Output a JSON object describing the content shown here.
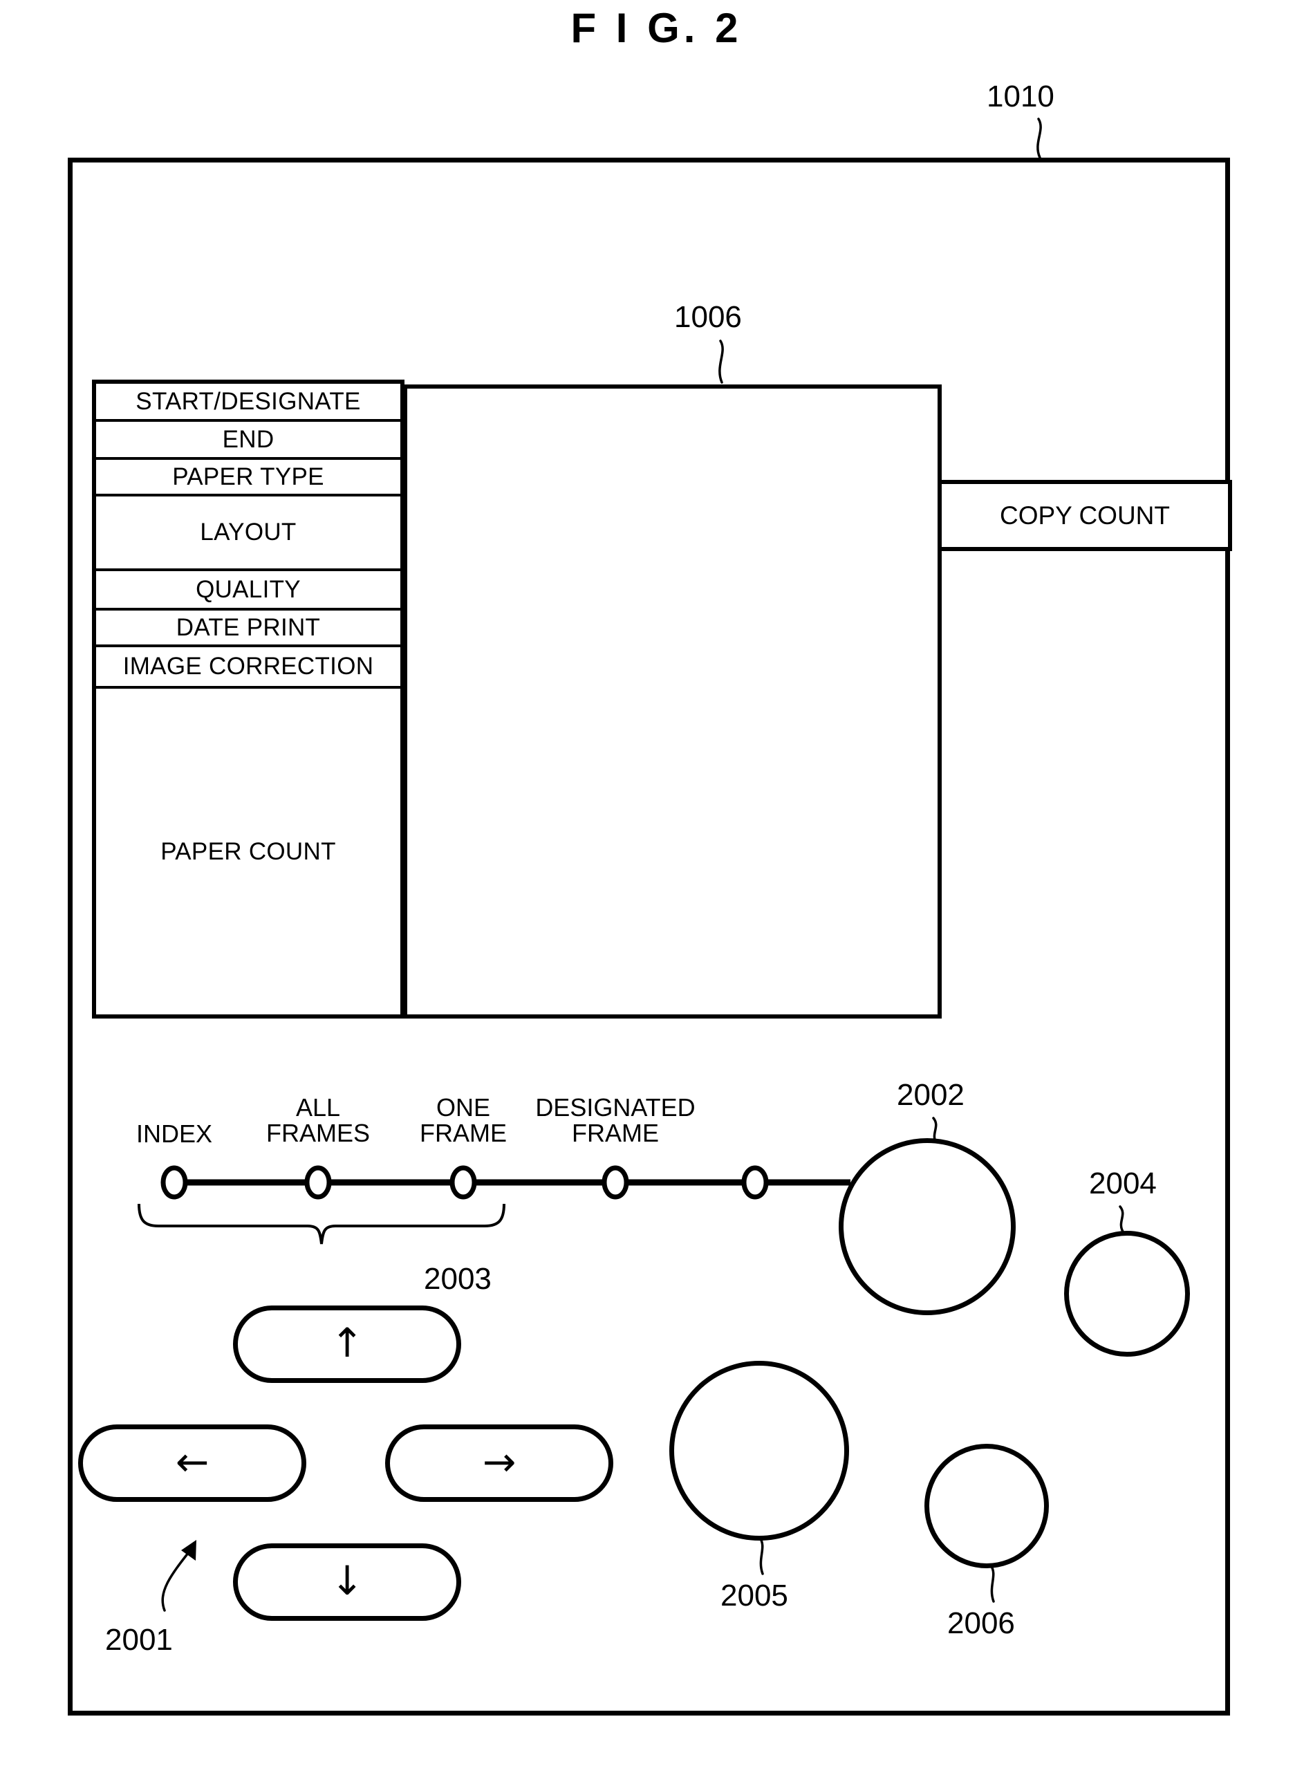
{
  "figure": {
    "title": "F I G.  2"
  },
  "device": {
    "ref": "1010",
    "display_panel_ref": "1006",
    "copy_count_label": "COPY COUNT"
  },
  "menu": {
    "items": [
      {
        "label": "START/DESIGNATE"
      },
      {
        "label": "END"
      },
      {
        "label": "PAPER TYPE"
      },
      {
        "label": "LAYOUT"
      },
      {
        "label": "QUALITY"
      },
      {
        "label": "DATE PRINT"
      },
      {
        "label": "IMAGE CORRECTION"
      },
      {
        "label": "PAPER COUNT"
      }
    ]
  },
  "mode_selector": {
    "ref": "2003",
    "labels": [
      {
        "line1": "INDEX",
        "line2": ""
      },
      {
        "line1": "ALL",
        "line2": "FRAMES"
      },
      {
        "line1": "ONE",
        "line2": "FRAME"
      },
      {
        "line1": "DESIGNATED",
        "line2": "FRAME"
      }
    ]
  },
  "arrow_pad": {
    "ref": "2001",
    "buttons": [
      {
        "name": "up",
        "glyph": "↑"
      },
      {
        "name": "left",
        "glyph": "←"
      },
      {
        "name": "right",
        "glyph": "→"
      },
      {
        "name": "down",
        "glyph": "↓"
      }
    ]
  },
  "round_buttons": [
    {
      "ref": "2002"
    },
    {
      "ref": "2004"
    },
    {
      "ref": "2005"
    },
    {
      "ref": "2006"
    }
  ]
}
